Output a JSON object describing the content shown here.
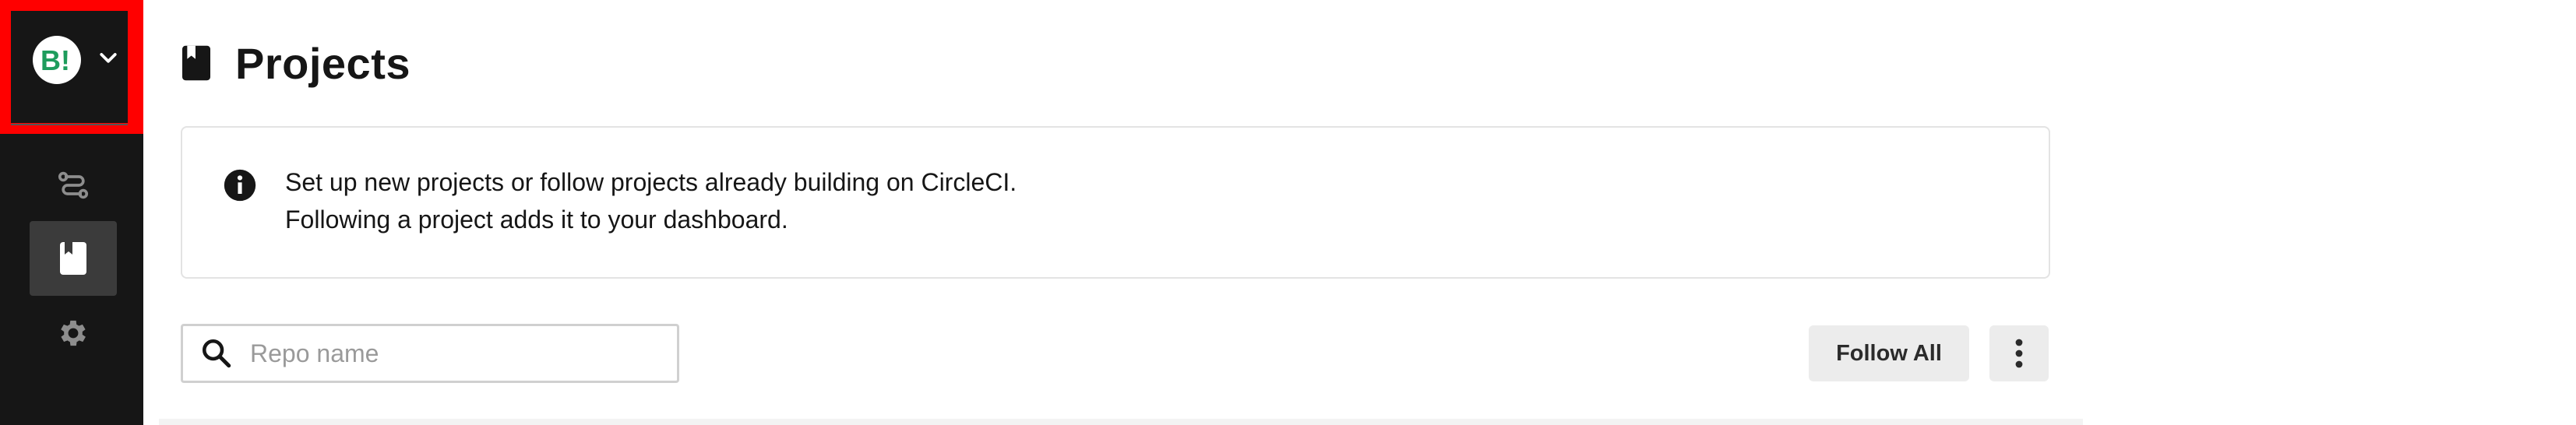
{
  "sidebar": {
    "org": {
      "avatar_text": "B!",
      "avatar_color": "#1e9c5c",
      "avatar_icon": "org-avatar",
      "dropdown_icon": "chevron-down-icon"
    },
    "items": [
      {
        "id": "pipelines",
        "icon": "pipelines-icon",
        "active": false
      },
      {
        "id": "projects",
        "icon": "projects-book-icon",
        "active": true
      },
      {
        "id": "organization-settings",
        "icon": "gear-icon",
        "active": false
      }
    ],
    "highlight_color": "#ff0000"
  },
  "main": {
    "title": "Projects",
    "title_icon": "book-icon",
    "info": {
      "icon": "info-icon",
      "line1": "Set up new projects or follow projects already building on CircleCI.",
      "line2": "Following a project adds it to your dashboard."
    },
    "search": {
      "placeholder": "Repo name",
      "value": "",
      "icon": "search-icon"
    },
    "actions": {
      "follow_all_label": "Follow All",
      "more_icon": "more-vertical-icon"
    }
  }
}
